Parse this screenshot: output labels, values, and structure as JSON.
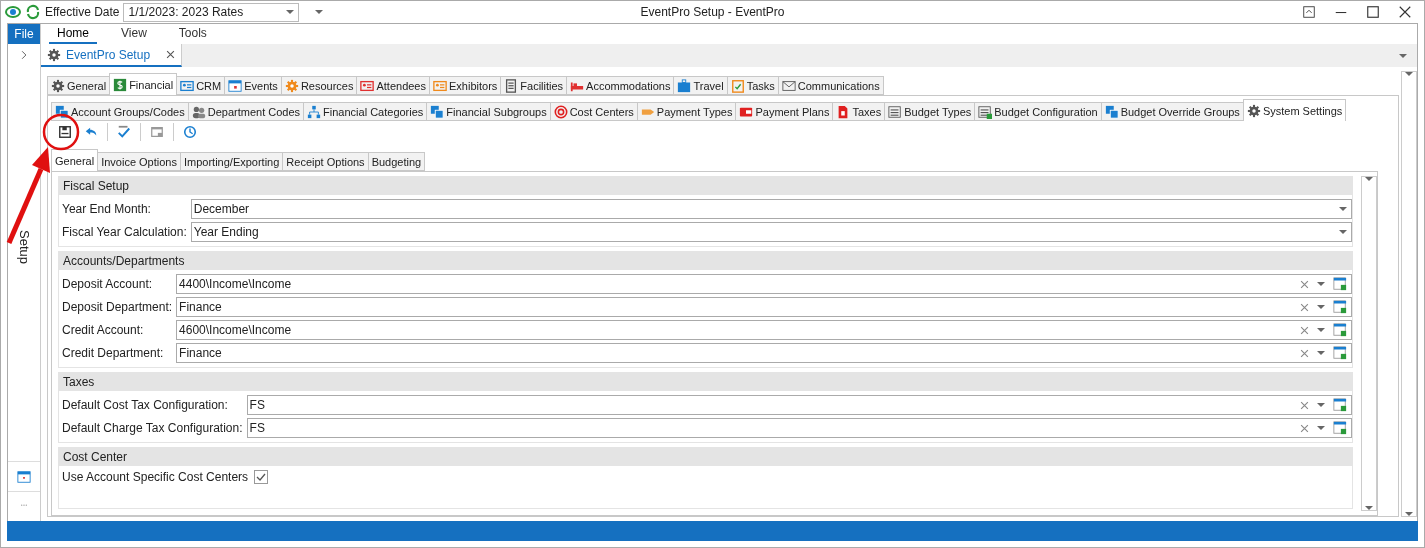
{
  "quick_bar": {
    "label": "Effective Date",
    "effective_date": "1/1/2023: 2023 Rates"
  },
  "window": {
    "title": "EventPro Setup - EventPro"
  },
  "file_button": "File",
  "ribbon_tabs": [
    {
      "label": "Home",
      "selected": true
    },
    {
      "label": "View",
      "selected": false
    },
    {
      "label": "Tools",
      "selected": false
    }
  ],
  "side_panel": {
    "label": "Setup"
  },
  "document_tab": {
    "label": "EventPro Setup"
  },
  "module_tabs": [
    {
      "label": "General",
      "selected": false
    },
    {
      "label": "Financial",
      "selected": true
    },
    {
      "label": "CRM",
      "selected": false
    },
    {
      "label": "Events",
      "selected": false
    },
    {
      "label": "Resources",
      "selected": false
    },
    {
      "label": "Attendees",
      "selected": false
    },
    {
      "label": "Exhibitors",
      "selected": false
    },
    {
      "label": "Facilities",
      "selected": false
    },
    {
      "label": "Accommodations",
      "selected": false
    },
    {
      "label": "Travel",
      "selected": false
    },
    {
      "label": "Tasks",
      "selected": false
    },
    {
      "label": "Communications",
      "selected": false
    }
  ],
  "sub_tabs": [
    {
      "label": "Account Groups/Codes",
      "selected": false
    },
    {
      "label": "Department Codes",
      "selected": false
    },
    {
      "label": "Financial Categories",
      "selected": false
    },
    {
      "label": "Financial Subgroups",
      "selected": false
    },
    {
      "label": "Cost Centers",
      "selected": false
    },
    {
      "label": "Payment Types",
      "selected": false
    },
    {
      "label": "Payment Plans",
      "selected": false
    },
    {
      "label": "Taxes",
      "selected": false
    },
    {
      "label": "Budget Types",
      "selected": false
    },
    {
      "label": "Budget Configuration",
      "selected": false
    },
    {
      "label": "Budget Override Groups",
      "selected": false
    },
    {
      "label": "System Settings",
      "selected": true
    }
  ],
  "page_tabs": [
    {
      "label": "General",
      "selected": true
    },
    {
      "label": "Invoice Options",
      "selected": false
    },
    {
      "label": "Importing/Exporting",
      "selected": false
    },
    {
      "label": "Receipt Options",
      "selected": false
    },
    {
      "label": "Budgeting",
      "selected": false
    }
  ],
  "sections": [
    {
      "title": "Fiscal Setup",
      "fields": [
        {
          "kind": "dropdown",
          "label": "Year End Month:",
          "value": "December"
        },
        {
          "kind": "dropdown",
          "label": "Fiscal Year Calculation:",
          "value": "Year Ending"
        }
      ]
    },
    {
      "title": "Accounts/Departments",
      "fields": [
        {
          "kind": "lookup",
          "label": "Deposit Account:",
          "value": "4400\\Income\\Income"
        },
        {
          "kind": "lookup",
          "label": "Deposit Department:",
          "value": "Finance"
        },
        {
          "kind": "lookup",
          "label": "Credit Account:",
          "value": "4600\\Income\\Income"
        },
        {
          "kind": "lookup",
          "label": "Credit Department:",
          "value": "Finance"
        }
      ]
    },
    {
      "title": "Taxes",
      "fields": [
        {
          "kind": "lookup",
          "label": "Default Cost Tax Configuration:",
          "value": "FS"
        },
        {
          "kind": "lookup",
          "label": "Default Charge Tax Configuration:",
          "value": "FS"
        }
      ]
    },
    {
      "title": "Cost Center",
      "fields": [
        {
          "kind": "checkbox",
          "label": "Use Account Specific Cost Centers",
          "checked": true
        }
      ]
    }
  ]
}
